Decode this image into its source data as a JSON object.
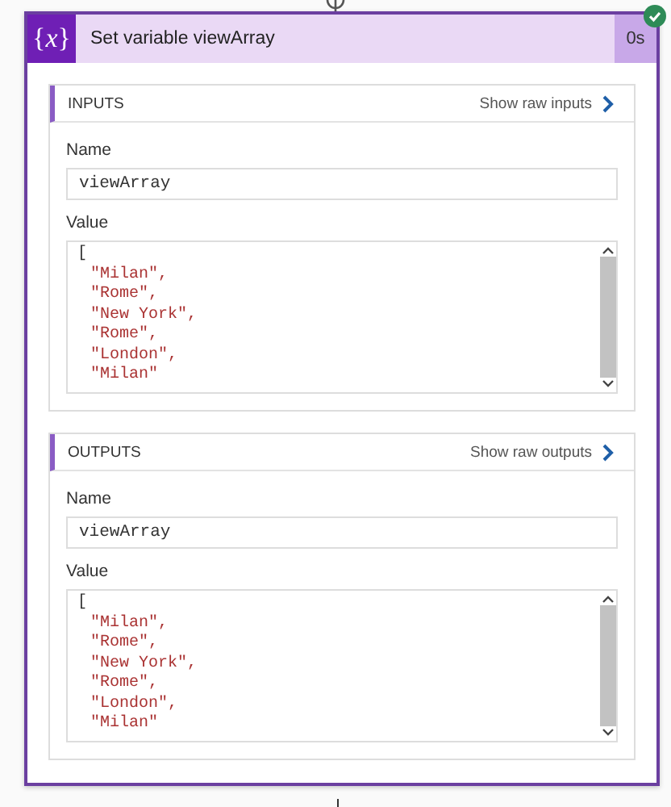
{
  "action": {
    "icon_text": "{*x*}",
    "title": "Set variable viewArray",
    "duration": "0s",
    "succeeded": true
  },
  "sections": [
    {
      "heading": "INPUTS",
      "link": "Show raw inputs",
      "fields": [
        {
          "label": "Name",
          "kind": "text",
          "value": "viewArray"
        },
        {
          "label": "Value",
          "kind": "code",
          "lines": [
            {
              "text": "[",
              "kind": "bracket"
            },
            {
              "text": "\"Milan\",",
              "kind": "string"
            },
            {
              "text": "\"Rome\",",
              "kind": "string"
            },
            {
              "text": "\"New York\",",
              "kind": "string"
            },
            {
              "text": "\"Rome\",",
              "kind": "string"
            },
            {
              "text": "\"London\",",
              "kind": "string"
            },
            {
              "text": "\"Milan\"",
              "kind": "string"
            }
          ]
        }
      ]
    },
    {
      "heading": "OUTPUTS",
      "link": "Show raw outputs",
      "fields": [
        {
          "label": "Name",
          "kind": "text",
          "value": "viewArray"
        },
        {
          "label": "Value",
          "kind": "code",
          "lines": [
            {
              "text": "[",
              "kind": "bracket"
            },
            {
              "text": "\"Milan\",",
              "kind": "string"
            },
            {
              "text": "\"Rome\",",
              "kind": "string"
            },
            {
              "text": "\"New York\",",
              "kind": "string"
            },
            {
              "text": "\"Rome\",",
              "kind": "string"
            },
            {
              "text": "\"London\",",
              "kind": "string"
            },
            {
              "text": "\"Milan\"",
              "kind": "string"
            }
          ]
        }
      ]
    }
  ]
}
